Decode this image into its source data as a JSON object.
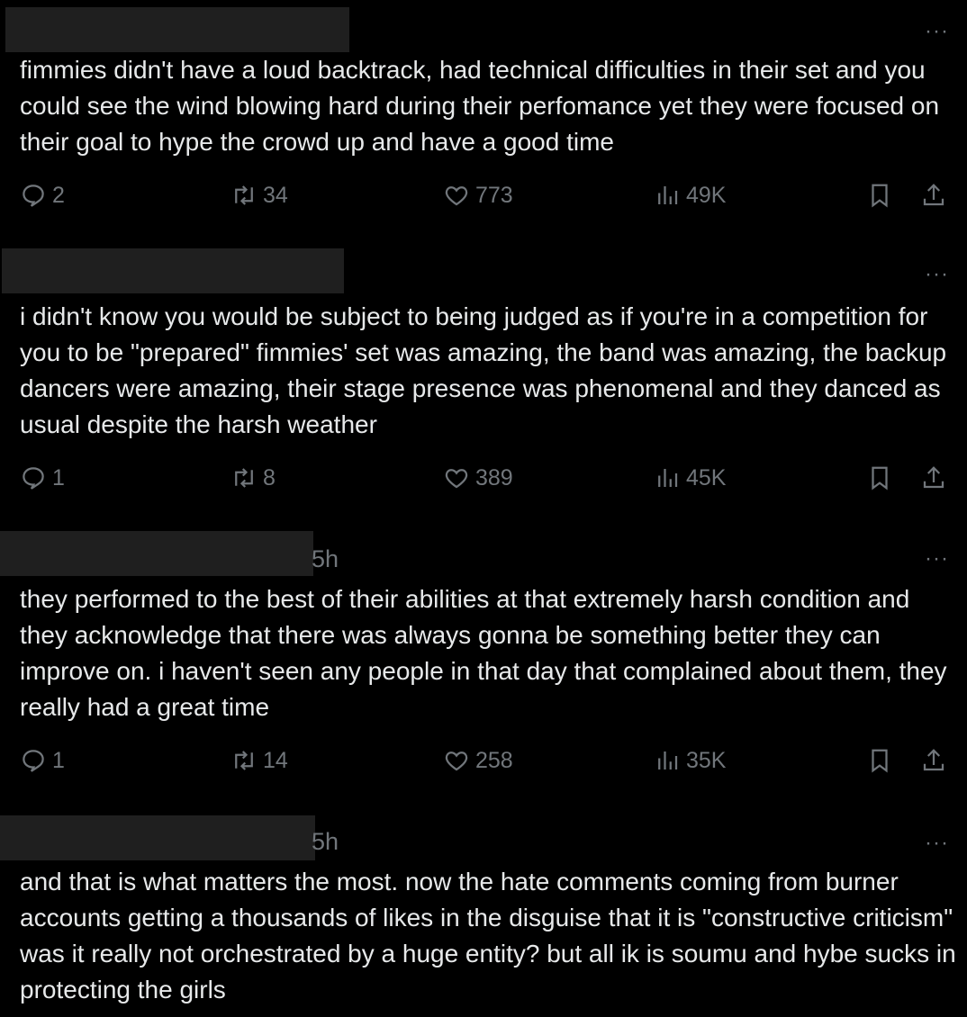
{
  "posts": [
    {
      "time": "",
      "more": "···",
      "text": "fimmies didn't have a loud backtrack, had technical difficulties in their set and you could see the wind blowing hard during their perfomance yet they were focused on their goal to hype the crowd up and have a good time",
      "replies": "2",
      "reposts": "34",
      "likes": "773",
      "views": "49K"
    },
    {
      "time": "",
      "more": "···",
      "text": "i didn't know you would be subject to being judged as if you're in a competition for you to be \"prepared\" fimmies' set was amazing, the band was amazing, the backup dancers were amazing, their stage presence was phenomenal and they danced as usual despite the harsh weather",
      "replies": "1",
      "reposts": "8",
      "likes": "389",
      "views": "45K"
    },
    {
      "time": "5h",
      "more": "···",
      "text": "they performed to the best of their abilities at that extremely harsh condition and they acknowledge that there was always gonna be something better they can improve on. i haven't seen any people in that day that complained about them, they really had a great time",
      "replies": "1",
      "reposts": "14",
      "likes": "258",
      "views": "35K"
    },
    {
      "time": "5h",
      "more": "···",
      "text": "and that is what matters the most. now the hate comments coming from burner accounts getting a thousands of likes in the disguise that it is \"constructive criticism\" was it really not orchestrated by a huge entity? but all ik is soumu and hybe sucks in protecting the girls"
    }
  ],
  "icons": {
    "reply": "reply-icon",
    "repost": "repost-icon",
    "like": "heart-icon",
    "views": "views-icon",
    "bookmark": "bookmark-icon",
    "share": "share-icon"
  },
  "colors": {
    "background": "#000000",
    "text": "#e7e9ea",
    "muted": "#71767b",
    "redaction": "#1f1f1f"
  }
}
